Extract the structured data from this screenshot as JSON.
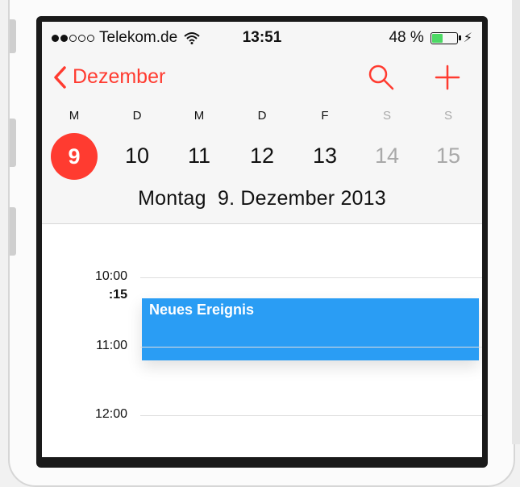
{
  "status_bar": {
    "carrier": "Telekom.de",
    "time": "13:51",
    "battery": "48 %",
    "battery_level": 0.48
  },
  "nav": {
    "back_label": "Dezember"
  },
  "week": {
    "days": [
      {
        "letter": "M",
        "number": "9"
      },
      {
        "letter": "D",
        "number": "10"
      },
      {
        "letter": "M",
        "number": "11"
      },
      {
        "letter": "D",
        "number": "12"
      },
      {
        "letter": "F",
        "number": "13"
      },
      {
        "letter": "S",
        "number": "14"
      },
      {
        "letter": "S",
        "number": "15"
      }
    ]
  },
  "selected_date": "Montag  9. Dezember 2013",
  "day_view": {
    "hours": [
      "10:00",
      "11:00",
      "12:00"
    ],
    "quarter_label": ":15",
    "event_title": "Neues Ereignis"
  },
  "colors": {
    "accent": "#ff3b30",
    "event": "#2a9df4",
    "battery": "#4cd964"
  }
}
